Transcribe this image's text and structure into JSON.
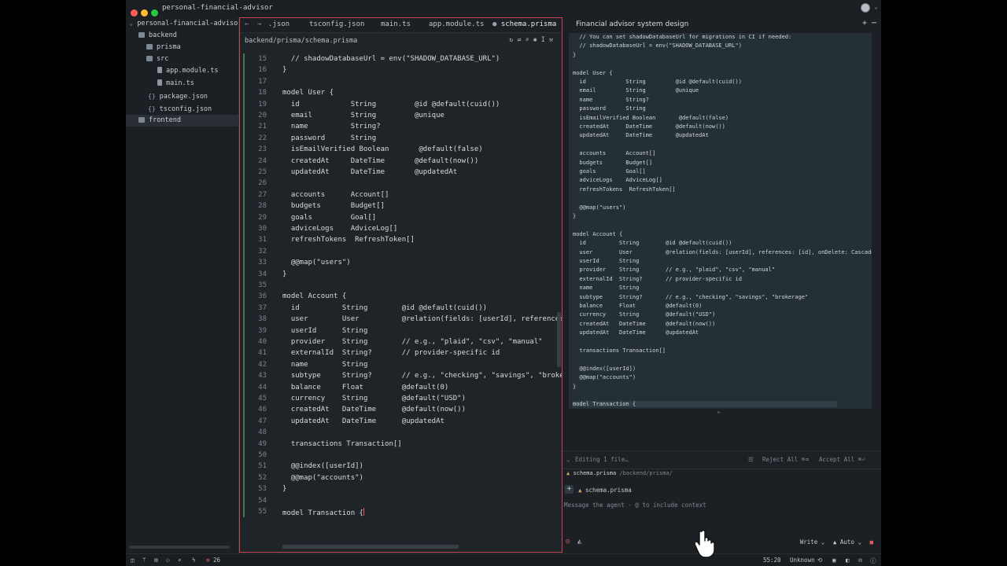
{
  "window": {
    "title": "personal-financial-advisor"
  },
  "sidebar": {
    "root": "personal-financial-adviso",
    "items": [
      {
        "label": "backend"
      },
      {
        "label": "prisma"
      },
      {
        "label": "src"
      },
      {
        "label": "app.module.ts"
      },
      {
        "label": "main.ts"
      },
      {
        "label": "package.json"
      },
      {
        "label": "tsconfig.json"
      },
      {
        "label": "frontend"
      }
    ]
  },
  "editor": {
    "back": "←",
    "forward": "→",
    "tabs": [
      {
        "label": ".json"
      },
      {
        "label": "tsconfig.json"
      },
      {
        "label": "main.ts"
      },
      {
        "label": "app.module.ts"
      },
      {
        "label": "schema.prisma"
      }
    ],
    "breadcrumb": "backend/prisma/schema.prisma",
    "line_numbers": [
      "15",
      "16",
      "17",
      "18",
      "19",
      "20",
      "21",
      "22",
      "23",
      "24",
      "25",
      "26",
      "27",
      "28",
      "29",
      "30",
      "31",
      "32",
      "33",
      "34",
      "35",
      "36",
      "37",
      "38",
      "39",
      "40",
      "41",
      "42",
      "43",
      "44",
      "45",
      "46",
      "47",
      "48",
      "49",
      "50",
      "51",
      "52",
      "53",
      "54",
      "55"
    ],
    "lines": [
      "  // shadowDatabaseUrl = env(\"SHADOW_DATABASE_URL\")",
      "}",
      "",
      "model User {",
      "  id            String         @id @default(cuid())",
      "  email         String         @unique",
      "  name          String?",
      "  password      String",
      "  isEmailVerified Boolean       @default(false)",
      "  createdAt     DateTime       @default(now())",
      "  updatedAt     DateTime       @updatedAt",
      "",
      "  accounts      Account[]",
      "  budgets       Budget[]",
      "  goals         Goal[]",
      "  adviceLogs    AdviceLog[]",
      "  refreshTokens  RefreshToken[]",
      "",
      "  @@map(\"users\")",
      "}",
      "",
      "model Account {",
      "  id          String        @id @default(cuid())",
      "  user        User          @relation(fields: [userId], references: [id], onDelete: Cascade)",
      "  userId      String",
      "  provider    String        // e.g., \"plaid\", \"csv\", \"manual\"",
      "  externalId  String?       // provider-specific id",
      "  name        String",
      "  subtype     String?       // e.g., \"checking\", \"savings\", \"brokerage\"",
      "  balance     Float         @default(0)",
      "  currency    String        @default(\"USD\")",
      "  createdAt   DateTime      @default(now())",
      "  updatedAt   DateTime      @updatedAt",
      "",
      "  transactions Transaction[]",
      "",
      "  @@index([userId])",
      "  @@map(\"accounts\")",
      "}",
      "",
      "model Transaction {"
    ]
  },
  "panel": {
    "title": "Financial advisor system design",
    "preview_lines": [
      "  // You can set shadowDatabaseUrl for migrations in CI if needed:",
      "  // shadowDatabaseUrl = env(\"SHADOW_DATABASE_URL\")",
      "}",
      "",
      "model User {",
      "  id            String         @id @default(cuid())",
      "  email         String         @unique",
      "  name          String?",
      "  password      String",
      "  isEmailVerified Boolean       @default(false)",
      "  createdAt     DateTime       @default(now())",
      "  updatedAt     DateTime       @updatedAt",
      "",
      "  accounts      Account[]",
      "  budgets       Budget[]",
      "  goals         Goal[]",
      "  adviceLogs    AdviceLog[]",
      "  refreshTokens  RefreshToken[]",
      "",
      "  @@map(\"users\")",
      "}",
      "",
      "model Account {",
      "  id          String        @id @default(cuid())",
      "  user        User          @relation(fields: [userId], references: [id], onDelete: Cascade)",
      "  userId      String",
      "  provider    String        // e.g., \"plaid\", \"csv\", \"manual\"",
      "  externalId  String?       // provider-specific id",
      "  name        String",
      "  subtype     String?       // e.g., \"checking\", \"savings\", \"brokerage\"",
      "  balance     Float         @default(0)",
      "  currency    String        @default(\"USD\")",
      "  createdAt   DateTime      @default(now())",
      "  updatedAt   DateTime      @updatedAt",
      "",
      "  transactions Transaction[]",
      "",
      "  @@index([userId])",
      "  @@map(\"accounts\")",
      "}",
      "",
      "model Transaction {"
    ],
    "editing_label": "Editing 1 file…",
    "reject_label": "Reject All",
    "reject_shortcut": "⌘⌫",
    "accept_label": "Accept All",
    "accept_shortcut": "⌘⏎",
    "file_name": "schema.prisma",
    "file_dir": "/backend/prisma/",
    "context_file": "schema.prisma",
    "message_placeholder": "Message the agent - @ to include context",
    "mode_label": "Write",
    "model_label": "Auto"
  },
  "status": {
    "problems": "26",
    "position": "55:20",
    "encoding": "Unknown"
  },
  "colors": {
    "accent_red": "#c2464e",
    "gutter_green": "#3f7e4b"
  }
}
